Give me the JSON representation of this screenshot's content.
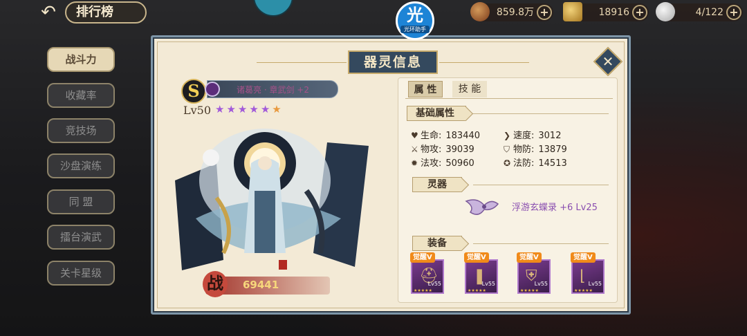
{
  "topbar": {
    "back_icon": "back-arrow-icon",
    "title": "排行榜",
    "resources": [
      {
        "icon": "coin-icon",
        "value": "859.8万"
      },
      {
        "icon": "gold-ingot-icon",
        "value": "18916"
      },
      {
        "icon": "stamina-icon",
        "value": "4/122"
      }
    ]
  },
  "watermark": {
    "glyph": "光",
    "text": "光环助手"
  },
  "sidebar": {
    "tabs": [
      {
        "label": "战斗力",
        "active": true
      },
      {
        "label": "收藏率",
        "active": false
      },
      {
        "label": "竞技场",
        "active": false
      },
      {
        "label": "沙盘演练",
        "active": false
      },
      {
        "label": "同 盟",
        "active": false
      },
      {
        "label": "擂台演武",
        "active": false
      },
      {
        "label": "关卡星级",
        "active": false
      }
    ]
  },
  "dialog": {
    "title": "器灵信息",
    "close_icon": "close-icon",
    "hero": {
      "grade": "S",
      "name": "诸葛亮 · 章武剑 +2",
      "level": "Lv50",
      "stars_purple": 5,
      "stars_orange": 1,
      "power_badge": "战",
      "power": "69441"
    },
    "tabs": {
      "attributes": "属 性",
      "skills": "技 能"
    },
    "base_stats": {
      "heading": "基础属性",
      "items": [
        {
          "icon": "heart-icon",
          "label": "生命:",
          "value": "183440"
        },
        {
          "icon": "speed-icon",
          "label": "速度:",
          "value": "3012"
        },
        {
          "icon": "sword-icon",
          "label": "物攻:",
          "value": "39039"
        },
        {
          "icon": "shield-icon",
          "label": "物防:",
          "value": "13879"
        },
        {
          "icon": "magic-icon",
          "label": "法攻:",
          "value": "50960"
        },
        {
          "icon": "magic-shield-icon",
          "label": "法防:",
          "value": "14513"
        }
      ]
    },
    "spirit": {
      "heading": "灵器",
      "name": "浮游玄蝶录 +6 Lv25"
    },
    "equipment": {
      "heading": "装备",
      "items": [
        {
          "tag": "觉醒V",
          "level": "Lv55",
          "icon": "helmet-icon"
        },
        {
          "tag": "觉醒V",
          "level": "Lv55",
          "icon": "bracer-icon"
        },
        {
          "tag": "觉醒V",
          "level": "Lv55",
          "icon": "armor-icon"
        },
        {
          "tag": "觉醒V",
          "level": "Lv55",
          "icon": "boots-icon"
        }
      ]
    }
  }
}
